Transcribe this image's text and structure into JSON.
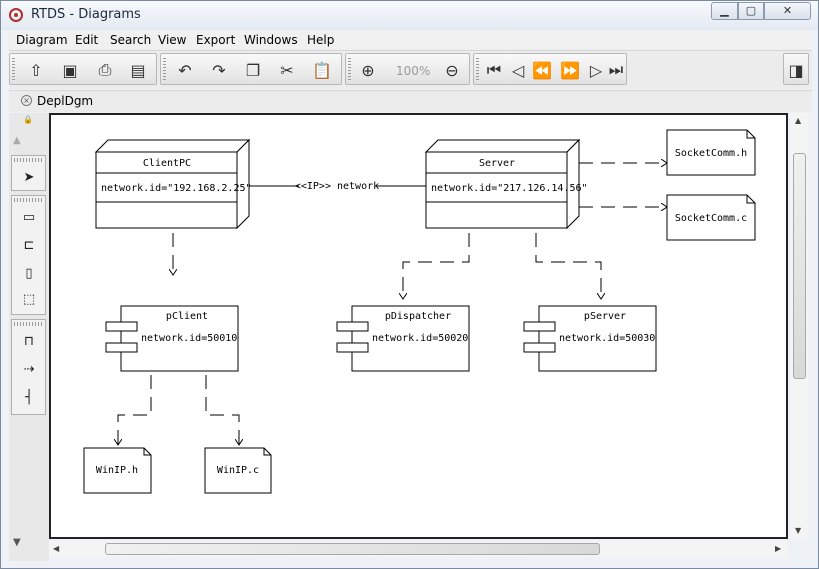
{
  "window": {
    "title": "RTDS - Diagrams"
  },
  "menubar": {
    "items": [
      "Diagram",
      "Edit",
      "Search",
      "View",
      "Export",
      "Windows",
      "Help"
    ]
  },
  "toolbar": {
    "zoom_label": "100%"
  },
  "tab": {
    "label": "DeplDgm"
  },
  "diagram": {
    "nodes": [
      {
        "title": "ClientPC",
        "attr": "network.id=\"192.168.2.25\""
      },
      {
        "title": "Server",
        "attr": "network.id=\"217.126.14.56\""
      }
    ],
    "link_label": "<<IP>> network",
    "components": [
      {
        "title": "pClient",
        "attr": "network.id=50010"
      },
      {
        "title": "pDispatcher",
        "attr": "network.id=50020"
      },
      {
        "title": "pServer",
        "attr": "network.id=50030"
      }
    ],
    "files": [
      "SocketComm.h",
      "SocketComm.c",
      "WinIP.h",
      "WinIP.c"
    ]
  }
}
